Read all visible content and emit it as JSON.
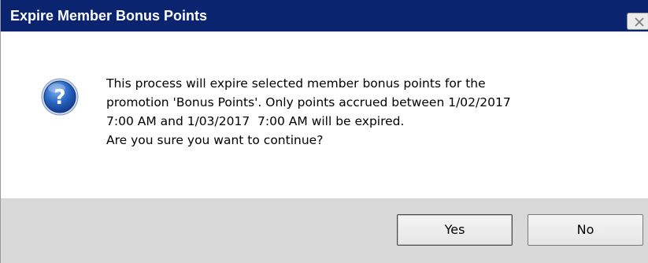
{
  "window": {
    "title": "Expire Member Bonus Points",
    "close_icon": "close-icon"
  },
  "dialog": {
    "icon": "question-icon",
    "message_lines": [
      "This process will expire selected member bonus points for the",
      "promotion 'Bonus Points'. Only points accrued between 1/02/2017",
      "7:00 AM and 1/03/2017  7:00 AM will be expired.",
      "Are you sure you want to continue?"
    ]
  },
  "buttons": {
    "yes_label": "Yes",
    "no_label": "No"
  },
  "colors": {
    "titlebar": "#0b2470",
    "button_panel": "#d9d9d9",
    "icon_blue": "#1f5fb4"
  }
}
